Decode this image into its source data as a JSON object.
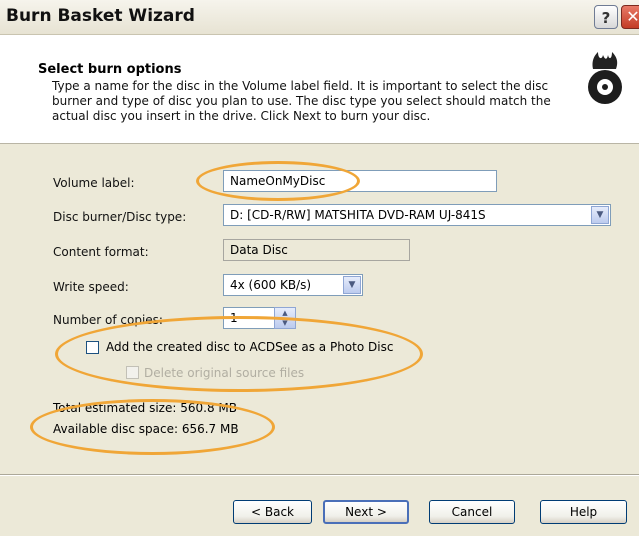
{
  "window": {
    "title": "Burn Basket Wizard",
    "help_label": "?",
    "close_label": "✕"
  },
  "header": {
    "title": "Select burn options",
    "description": "Type a name for the disc in the Volume label field.  It is important to select the disc burner and type of disc you plan to use.  The disc type you select should match the actual disc you insert in the drive.  Click Next to burn your disc.",
    "logo_icon": "flame-disc-logo"
  },
  "form": {
    "volume_label": {
      "label": "Volume label:",
      "value": "NameOnMyDisc"
    },
    "disc_burner": {
      "label": "Disc burner/Disc type:",
      "value": "D: [CD-R/RW] MATSHITA DVD-RAM UJ-841S"
    },
    "content_format": {
      "label": "Content format:",
      "value": "Data Disc"
    },
    "write_speed": {
      "label": "Write speed:",
      "value": "4x (600 KB/s)"
    },
    "copies": {
      "label": "Number of copies:",
      "value": "1"
    },
    "add_to_acdsee": {
      "label": "Add the created disc to ACDSee as a Photo Disc",
      "checked": false
    },
    "delete_originals": {
      "label": "Delete original source files",
      "checked": false,
      "enabled": false
    }
  },
  "info": {
    "total_size_label": "Total estimated size:",
    "total_size_value": "560.8 MB",
    "available_label": "Available disc space:",
    "available_value": "656.7 MB"
  },
  "buttons": {
    "back": "< Back",
    "next": "Next >",
    "cancel": "Cancel",
    "help": "Help"
  },
  "colors": {
    "highlight_ring": "#f0a637",
    "dialog_bg": "#ece9d8"
  }
}
